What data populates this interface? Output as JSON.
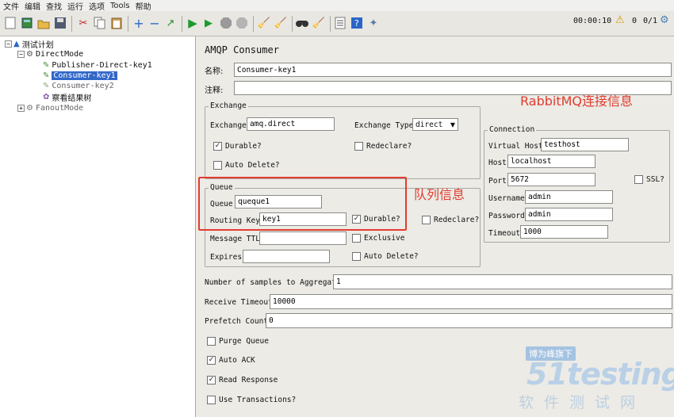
{
  "menu": [
    "文件",
    "编辑",
    "查找",
    "运行",
    "选项",
    "Tools",
    "帮助"
  ],
  "toolbar": {
    "elapsed": "00:00:10",
    "warnings": "0",
    "threads": "0/1"
  },
  "tree": {
    "root": "测试计划",
    "group1": "DirectMode",
    "items": [
      "Publisher-Direct-key1",
      "Consumer-key1",
      "Consumer-key2",
      "察看结果树"
    ],
    "group2": "FanoutMode"
  },
  "panel": {
    "title": "AMQP Consumer",
    "name_label": "名称:",
    "name_value": "Consumer-key1",
    "comment_label": "注释:",
    "exchange": {
      "title": "Exchange",
      "exchange_label": "Exchange",
      "exchange_value": "amq.direct",
      "type_label": "Exchange Type",
      "type_value": "direct",
      "durable": "Durable?",
      "redeclare": "Redeclare?",
      "auto_delete": "Auto Delete?"
    },
    "queue": {
      "title": "Queue",
      "queue_label": "Queue",
      "queue_value": "queque1",
      "routing_label": "Routing Key",
      "routing_value": "key1",
      "durable": "Durable?",
      "redeclare": "Redeclare?",
      "ttl_label": "Message TTL",
      "exclusive": "Exclusive",
      "expires_label": "Expires",
      "auto_delete": "Auto Delete?"
    },
    "connection": {
      "title": "Connection",
      "vhost_label": "Virtual Host",
      "vhost_value": "testhost",
      "host_label": "Host",
      "host_value": "localhost",
      "port_label": "Port",
      "port_value": "5672",
      "ssl": "SSL?",
      "user_label": "Username",
      "user_value": "admin",
      "pass_label": "Password",
      "pass_value": "admin",
      "timeout_label": "Timeout",
      "timeout_value": "1000"
    },
    "samples_label": "Number of samples to Aggregate",
    "samples_value": "1",
    "receive_label": "Receive Timeout",
    "receive_value": "10000",
    "prefetch_label": "Prefetch Count",
    "prefetch_value": "0",
    "purge": "Purge Queue",
    "auto_ack": "Auto ACK",
    "read_response": "Read Response",
    "transactions": "Use Transactions?"
  },
  "annotations": {
    "rabbitmq": "RabbitMQ连接信息",
    "queue": "队列信息"
  },
  "watermark": {
    "line1": "博为峰旗下",
    "line2": "51testing",
    "line3": "软件测试网"
  },
  "colors": {
    "selection": "#3267c8",
    "annotation_red": "#e23c2e"
  }
}
